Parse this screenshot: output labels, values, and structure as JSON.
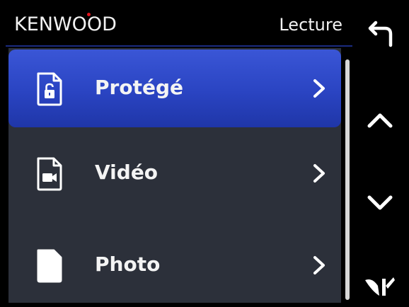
{
  "header": {
    "brand": "KENWOOD",
    "title": "Lecture"
  },
  "menu": {
    "items": [
      {
        "label": "Protégé",
        "icon": "protected-file-icon",
        "selected": true
      },
      {
        "label": "Vidéo",
        "icon": "video-file-icon",
        "selected": false
      },
      {
        "label": "Photo",
        "icon": "photo-file-icon",
        "selected": false
      }
    ]
  },
  "side_buttons": {
    "back": "back-arrow-icon",
    "up": "chevron-up-icon",
    "down": "chevron-down-icon",
    "extra": "mark-icon"
  },
  "colors": {
    "background": "#000000",
    "list_background": "#2c303a",
    "selected": "#2a44c2",
    "text": "#f4f4f4",
    "brand_accent": "#e0141e"
  }
}
